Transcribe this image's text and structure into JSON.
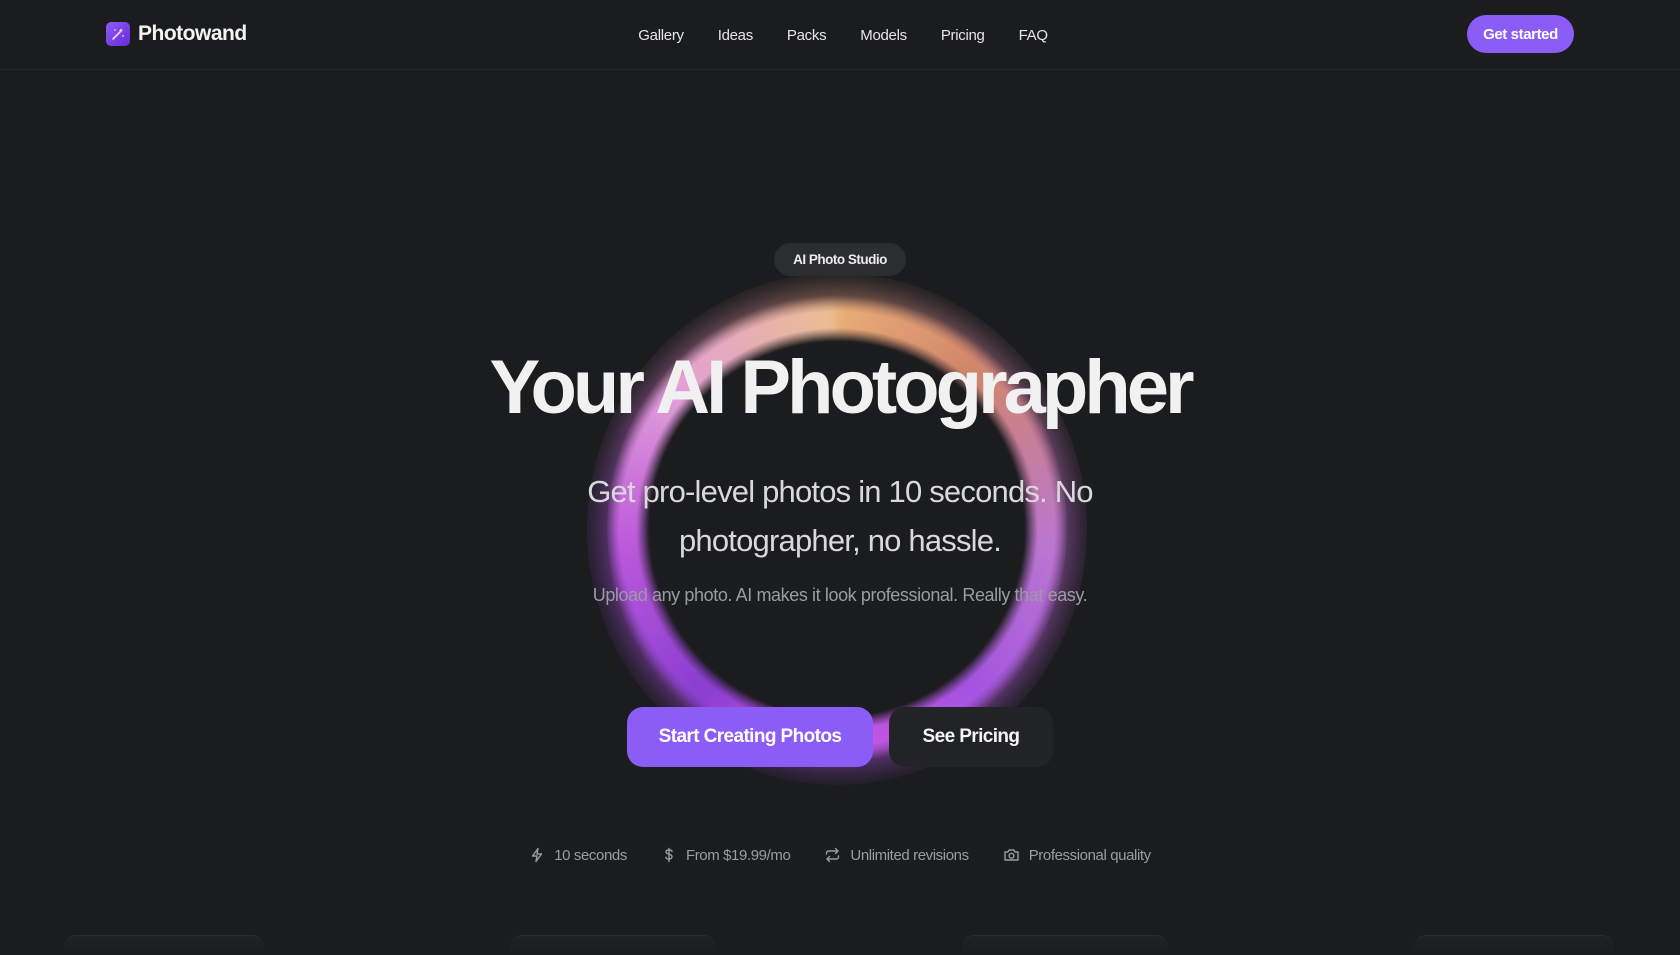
{
  "brand": {
    "name": "Photowand"
  },
  "nav": {
    "items": [
      {
        "label": "Gallery"
      },
      {
        "label": "Ideas"
      },
      {
        "label": "Packs"
      },
      {
        "label": "Models"
      },
      {
        "label": "Pricing"
      },
      {
        "label": "FAQ"
      }
    ],
    "cta_label": "Get started"
  },
  "hero": {
    "badge": "AI Photo Studio",
    "title": "Your AI Photographer",
    "subtitle": "Get pro-level photos in 10 seconds. No photographer, no hassle.",
    "note": "Upload any photo. AI makes it look professional. Really that easy.",
    "primary_button": "Start Creating Photos",
    "secondary_button": "See Pricing"
  },
  "features": [
    {
      "icon": "lightning-icon",
      "label": "10 seconds"
    },
    {
      "icon": "dollar-icon",
      "label": "From $19.99/mo"
    },
    {
      "icon": "repeat-icon",
      "label": "Unlimited revisions"
    },
    {
      "icon": "camera-icon",
      "label": "Professional quality"
    }
  ],
  "colors": {
    "background": "#1b1c1e",
    "accent": "#8b5cf6",
    "text": "#f1f1f2",
    "muted": "#9b9ca2"
  }
}
